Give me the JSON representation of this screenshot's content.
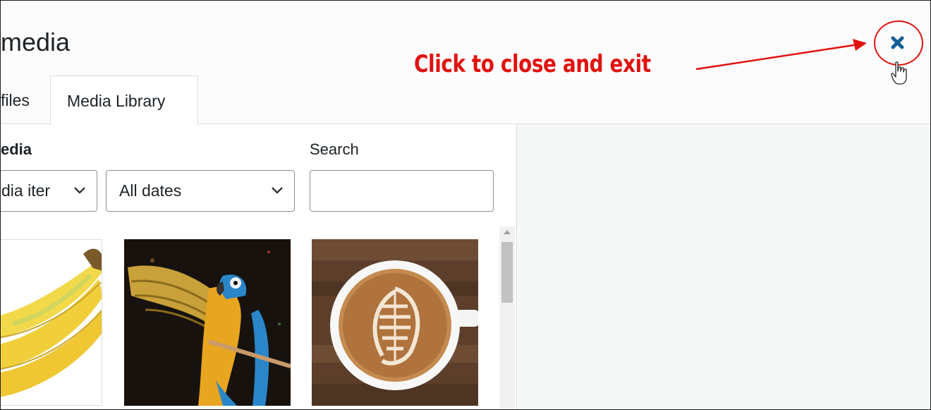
{
  "header": {
    "title": "media",
    "tabs": [
      {
        "label": "files",
        "active": false
      },
      {
        "label": "Media Library",
        "active": true
      }
    ],
    "close_icon": "close-x-icon"
  },
  "annotation": {
    "text": "Click to close and exit",
    "color": "#e0120f"
  },
  "filters": {
    "type_label": "edia",
    "type_value": "dia iter",
    "date_value": "All dates",
    "search_label": "Search",
    "search_value": ""
  },
  "media_items": [
    {
      "name": "bananas",
      "icon": "banana-image"
    },
    {
      "name": "parrot",
      "icon": "parrot-image"
    },
    {
      "name": "coffee",
      "icon": "coffee-image"
    }
  ],
  "colors": {
    "accent": "#135e96",
    "annotation_red": "#e0120f",
    "sidebar_bg": "#f6f7f7"
  }
}
